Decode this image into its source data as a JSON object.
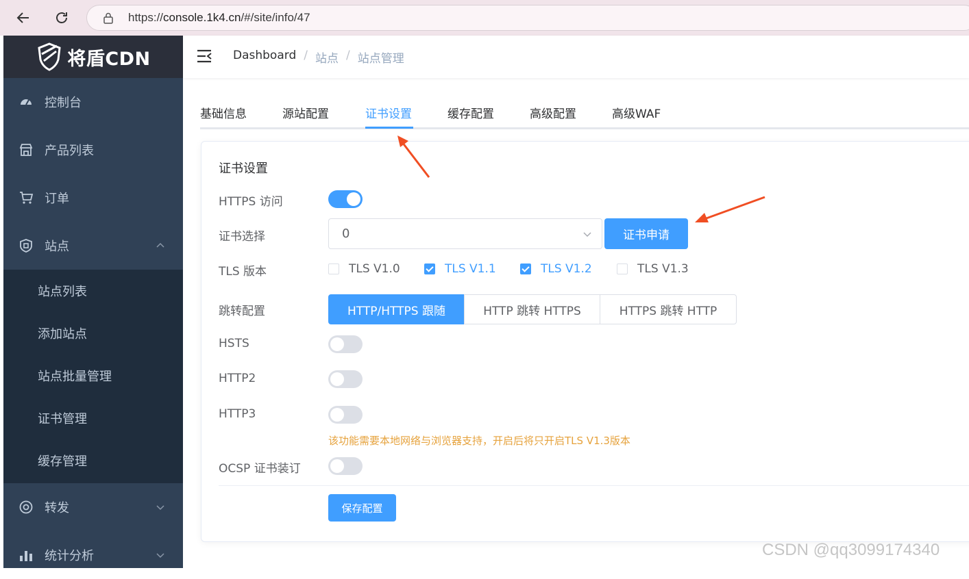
{
  "browser": {
    "url_prefix": "https://",
    "url_host": "console.1k4.cn",
    "url_path": "/#/site/info/47"
  },
  "sidebar": {
    "logo_text": "将盾CDN",
    "items": [
      {
        "label": "控制台",
        "icon": "dashboard-icon"
      },
      {
        "label": "产品列表",
        "icon": "store-icon"
      },
      {
        "label": "订单",
        "icon": "cart-icon"
      },
      {
        "label": "站点",
        "icon": "shield-icon",
        "expanded": true
      },
      {
        "label": "转发",
        "icon": "forward-icon"
      },
      {
        "label": "统计分析",
        "icon": "bar-chart-icon"
      }
    ],
    "site_submenu": [
      "站点列表",
      "添加站点",
      "站点批量管理",
      "证书管理",
      "缓存管理"
    ]
  },
  "header": {
    "breadcrumb": [
      "Dashboard",
      "站点",
      "站点管理"
    ]
  },
  "tabs": {
    "items": [
      "基础信息",
      "源站配置",
      "证书设置",
      "缓存配置",
      "高级配置",
      "高级WAF"
    ],
    "active": "证书设置"
  },
  "form": {
    "title": "证书设置",
    "https_label": "HTTPS 访问",
    "https_enabled": true,
    "cert_label": "证书选择",
    "cert_value": "0",
    "cert_apply_button": "证书申请",
    "tls_label": "TLS 版本",
    "tls_options": [
      {
        "label": "TLS V1.0",
        "checked": false
      },
      {
        "label": "TLS V1.1",
        "checked": true
      },
      {
        "label": "TLS V1.2",
        "checked": true
      },
      {
        "label": "TLS V1.3",
        "checked": false
      }
    ],
    "redirect_label": "跳转配置",
    "redirect_options": [
      "HTTP/HTTPS 跟随",
      "HTTP 跳转 HTTPS",
      "HTTPS 跳转 HTTP"
    ],
    "redirect_selected": "HTTP/HTTPS 跟随",
    "hsts_label": "HSTS",
    "hsts_enabled": false,
    "http2_label": "HTTP2",
    "http2_enabled": false,
    "http3_label": "HTTP3",
    "http3_enabled": false,
    "http3_note": "该功能需要本地网络与浏览器支持，开启后将只开启TLS V1.3版本",
    "ocsp_label": "OCSP 证书装订",
    "ocsp_enabled": false,
    "save_button": "保存配置"
  },
  "colors": {
    "primary": "#409eff",
    "sidebar_bg": "#304156",
    "submenu_bg": "#1f2d3d",
    "warning": "#e6a23c",
    "annotation_arrow": "#f04e23"
  },
  "watermark": "CSDN @qq3099174340"
}
